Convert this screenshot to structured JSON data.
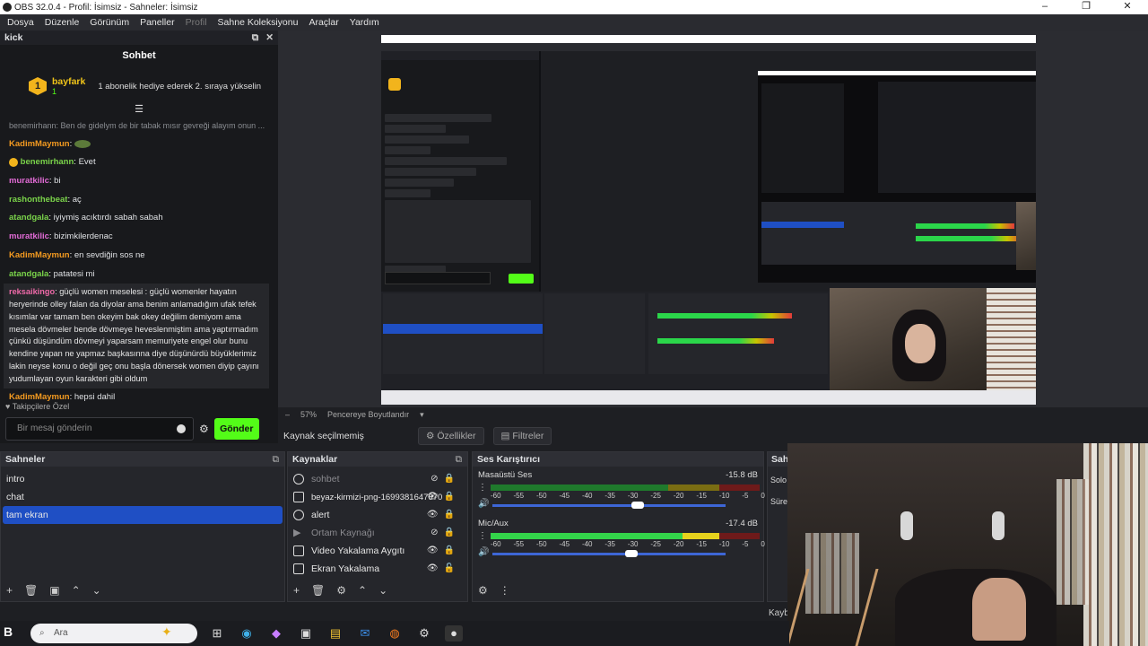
{
  "window": {
    "title": "OBS 32.0.4 - Profil: İsimsiz - Sahneler: İsimsiz",
    "controls": [
      "–",
      "❐",
      "✕"
    ]
  },
  "menu": [
    "Dosya",
    "Düzenle",
    "Görünüm",
    "Paneller",
    "Profil",
    "Sahne Koleksiyonu",
    "Araçlar",
    "Yardım"
  ],
  "chat": {
    "dock_title": "kick",
    "title": "Sohbet",
    "pinned": {
      "badge": "1",
      "user": "bayfark",
      "sub": "1",
      "message": "1 abonelik hediye ederek 2. sıraya yükselin"
    },
    "reply_line": "benemirhann: Ben de gidelym de bir tabak mısır gevreği alayım onun ...",
    "messages": [
      {
        "user": "KadimMaymun",
        "text": "",
        "color": "#f39a20"
      },
      {
        "user": "benemirhann",
        "text": "Evet",
        "color": "#7ad34a"
      },
      {
        "user": "muratkilic",
        "text": "bi",
        "color": "#e26bd6"
      },
      {
        "user": "rashonthebeat",
        "text": "aç",
        "color": "#7ad34a"
      },
      {
        "user": "atandgala",
        "text": "iyiymiş acıktırdı sabah sabah",
        "color": "#7ad34a"
      },
      {
        "user": "muratkilic",
        "text": "bizimkilerdenac",
        "color": "#e26bd6"
      },
      {
        "user": "KadimMaymun",
        "text": "en sevdiğin sos ne",
        "color": "#f39a20"
      },
      {
        "user": "atandgala",
        "text": "patatesi mi",
        "color": "#7ad34a"
      }
    ],
    "long_message": {
      "user": "reksaikingo",
      "text": "güçlü women meselesi : güçlü womenler hayatın heryerinde olley falan da diyolar ama benim anlamadığım ufak tefek kısımlar var tamam ben okeyim bak okey değilim demiyom ama mesela dövmeler bende dövmeye heveslenmiştim ama yaptırmadım çünkü düşündüm dövmeyi yaparsam memuriyete engel olur bunu kendine yapan ne yapmaz başkasınna diye düşünürdü büyüklerimiz lakin neyse konu o değil geç onu başla dönersek women diyip çayını yudumlayan oyun karakteri gibi oldum"
    },
    "last_message": {
      "user": "KadimMaymun",
      "text": "hepsi dahil"
    },
    "followers_only": "Takipçilere Özel",
    "input_placeholder": "Bir mesaj gönderin",
    "send_label": "Gönder"
  },
  "preview": {
    "zoom": "57%",
    "fit_label": "Pencereye Boyutlandır"
  },
  "source_toolbar": {
    "no_source": "Kaynak seçilmemiş",
    "properties": "Özellikler",
    "filters": "Filtreler"
  },
  "scenes": {
    "title": "Sahneler",
    "items": [
      "intro",
      "chat",
      "tam ekran"
    ],
    "selected": 2
  },
  "sources": {
    "title": "Kaynaklar",
    "items": [
      {
        "name": "sohbet",
        "dim": true
      },
      {
        "name": "beyaz-kirmizi-png-1699381647670",
        "dim": false
      },
      {
        "name": "alert",
        "dim": false
      },
      {
        "name": "Ortam Kaynağı",
        "dim": true
      },
      {
        "name": "Video Yakalama Aygıtı",
        "dim": false
      },
      {
        "name": "Ekran Yakalama",
        "dim": false
      }
    ]
  },
  "mixer": {
    "title": "Ses Karıştırıcı",
    "ticks": [
      "-60",
      "-55",
      "-50",
      "-45",
      "-40",
      "-35",
      "-30",
      "-25",
      "-20",
      "-15",
      "-10",
      "-5",
      "0"
    ],
    "tracks": [
      {
        "name": "Masaüstü Ses",
        "db": "-15.8 dB",
        "level": 0.0,
        "volume": 0.63
      },
      {
        "name": "Mic/Aux",
        "db": "-17.4 dB",
        "level": 0.85,
        "volume": 0.6
      }
    ]
  },
  "side_dock": {
    "title": "Sahn",
    "btn1": "Solo",
    "btn2": "Süre",
    "footer": "Kaybe"
  },
  "taskbar": {
    "logo": "B",
    "search": "Ara",
    "icons": [
      "⊞",
      "◉",
      "◆",
      "▣",
      "▤",
      "✉",
      "◍",
      "⚙",
      "●"
    ]
  }
}
